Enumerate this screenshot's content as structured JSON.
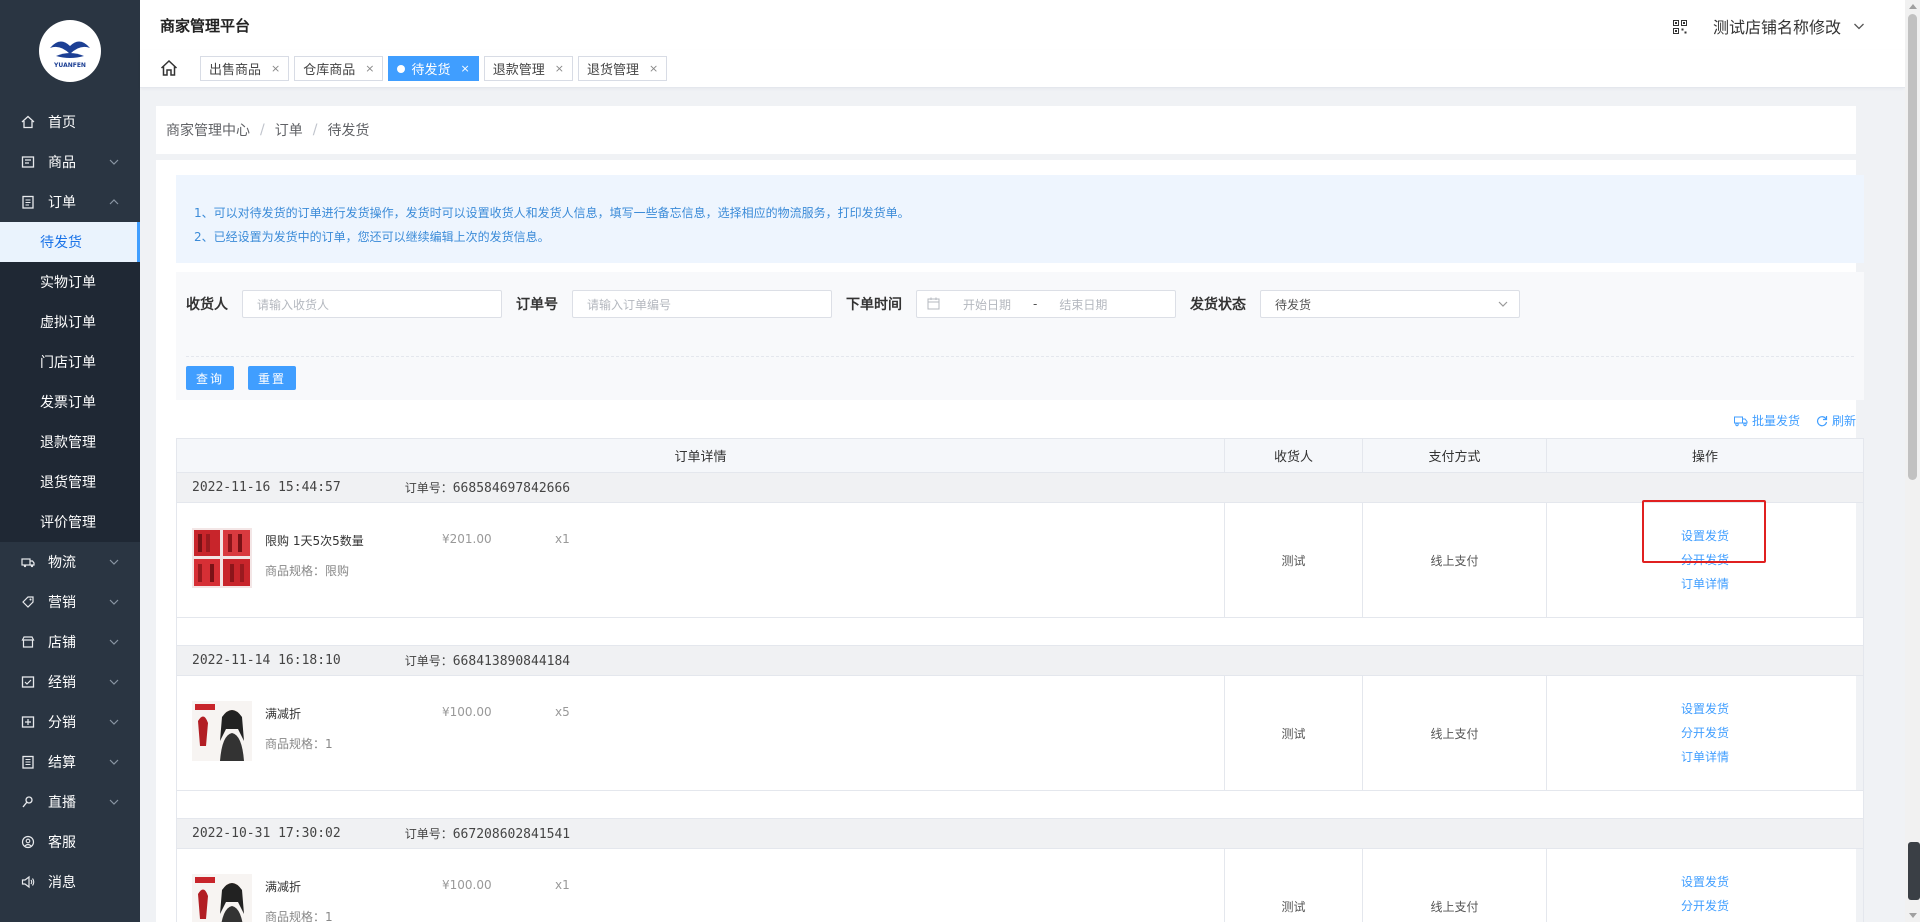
{
  "sidebar": {
    "logo_text": "YUANFEN",
    "items": [
      {
        "label": "首页",
        "icon": "home-icon",
        "chevron": false
      },
      {
        "label": "商品",
        "icon": "goods-icon",
        "chevron": "down"
      },
      {
        "label": "订单",
        "icon": "order-icon",
        "chevron": "up"
      }
    ],
    "order_sub": [
      "待发货",
      "实物订单",
      "虚拟订单",
      "门店订单",
      "发票订单",
      "退款管理",
      "退货管理",
      "评价管理"
    ],
    "items_after": [
      {
        "label": "物流",
        "icon": "truck-icon"
      },
      {
        "label": "营销",
        "icon": "tag-icon"
      },
      {
        "label": "店铺",
        "icon": "store-icon"
      },
      {
        "label": "经销",
        "icon": "dealer-icon"
      },
      {
        "label": "分销",
        "icon": "distribution-icon"
      },
      {
        "label": "结算",
        "icon": "settlement-icon"
      },
      {
        "label": "直播",
        "icon": "live-icon"
      },
      {
        "label": "客服",
        "icon": "service-icon"
      },
      {
        "label": "消息",
        "icon": "message-icon"
      }
    ]
  },
  "header": {
    "title": "商家管理平台",
    "store_name": "测试店铺名称修改"
  },
  "tabs": [
    {
      "label": "出售商品",
      "active": false
    },
    {
      "label": "仓库商品",
      "active": false
    },
    {
      "label": "待发货",
      "active": true
    },
    {
      "label": "退款管理",
      "active": false
    },
    {
      "label": "退货管理",
      "active": false
    }
  ],
  "breadcrumb": [
    "商家管理中心",
    "订单",
    "待发货"
  ],
  "tips": [
    "1、可以对待发货的订单进行发货操作，发货时可以设置收货人和发货人信息，填写一些备忘信息，选择相应的物流服务，打印发货单。",
    "2、已经设置为发货中的订单，您还可以继续编辑上次的发货信息。"
  ],
  "filter": {
    "receiver_label": "收货人",
    "receiver_placeholder": "请输入收货人",
    "order_no_label": "订单号",
    "order_no_placeholder": "请输入订单编号",
    "date_label": "下单时间",
    "date_start_placeholder": "开始日期",
    "date_separator": "-",
    "date_end_placeholder": "结束日期",
    "status_label": "发货状态",
    "status_value": "待发货",
    "query_button": "查询",
    "reset_button": "重置"
  },
  "toolbar": {
    "batch_ship": "批量发货",
    "refresh": "刷新"
  },
  "table": {
    "columns": [
      "订单详情",
      "收货人",
      "支付方式",
      "操作"
    ],
    "order_no_prefix": "订单号：",
    "orders": [
      {
        "time": "2022-11-16 15:44:57",
        "order_no": "668584697842666",
        "product_name": "限购 1天5次5数量",
        "spec": "商品规格：限购",
        "price": "¥201.00",
        "qty": "x1",
        "receiver": "测试",
        "payment": "线上支付"
      },
      {
        "time": "2022-11-14 16:18:10",
        "order_no": "668413890844184",
        "product_name": "满减折",
        "spec": "商品规格：1",
        "price": "¥100.00",
        "qty": "x5",
        "receiver": "测试",
        "payment": "线上支付"
      },
      {
        "time": "2022-10-31 17:30:02",
        "order_no": "667208602841541",
        "product_name": "满减折",
        "spec": "商品规格：1",
        "price": "¥100.00",
        "qty": "x1",
        "receiver": "测试",
        "payment": "线上支付"
      }
    ],
    "actions": [
      "设置发货",
      "分开发货",
      "订单详情"
    ]
  },
  "colors": {
    "sidebar_bg": "#2a3542",
    "accent": "#409eff",
    "highlight_box": "#e02020"
  }
}
